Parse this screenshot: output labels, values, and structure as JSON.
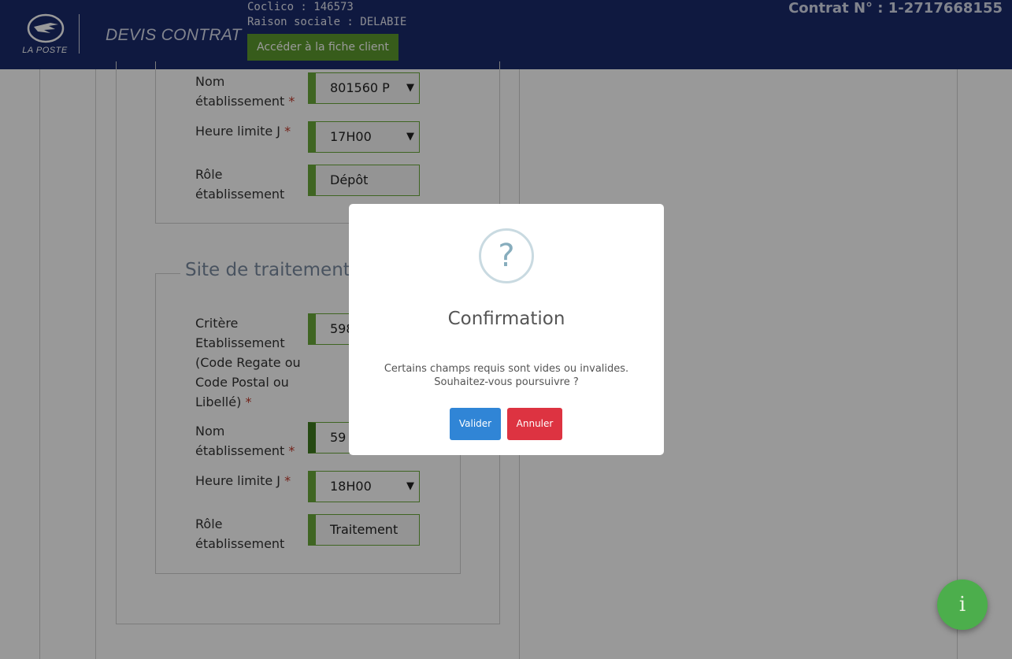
{
  "header": {
    "logo_text": "LA POSTE",
    "app_title": "DEVIS CONTRAT",
    "coclico_line": "Coclico : 146573",
    "raison_line": "Raison sociale : DELABIE",
    "client_button": "Accéder à la fiche client",
    "contract_number": "Contrat N° : 1-2717668155"
  },
  "section_depot": {
    "name_label_1": "Nom",
    "name_label_2": "établissement",
    "name_value": "801560 P",
    "heure_label": "Heure limite J",
    "heure_value": "17H00",
    "role_label_1": "Rôle",
    "role_label_2": "établissement",
    "role_value": "Dépôt"
  },
  "section_traitement": {
    "legend": "Site de traitement",
    "critere_label_1": "Critère",
    "critere_label_2": "Etablissement",
    "critere_label_3": "(Code Regate ou",
    "critere_label_4": "Code Postal ou",
    "critere_label_5": "Libellé)",
    "critere_value": "598",
    "name_label_1": "Nom",
    "name_label_2": "établissement",
    "name_value": "59",
    "heure_label": "Heure limite J",
    "heure_value": "18H00",
    "role_label_1": "Rôle",
    "role_label_2": "établissement",
    "role_value": "Traitement"
  },
  "required_mark": "*",
  "modal": {
    "icon_glyph": "?",
    "title": "Confirmation",
    "message_line1": "Certains champs requis sont vides ou invalides.",
    "message_line2": "Souhaitez-vous poursuivre ?",
    "confirm_label": "Valider",
    "cancel_label": "Annuler"
  },
  "fab": {
    "glyph": "i"
  },
  "colors": {
    "header_bg": "#1a2a6c",
    "accent_green": "#5c9a2d",
    "confirm_blue": "#3085d6",
    "cancel_red": "#dd3341",
    "fab_green": "#4cae4c"
  },
  "icons": {
    "logo": "la-poste-bird-logo",
    "select_arrow": "chevron-down-icon",
    "question": "question-icon",
    "info": "info-icon"
  }
}
